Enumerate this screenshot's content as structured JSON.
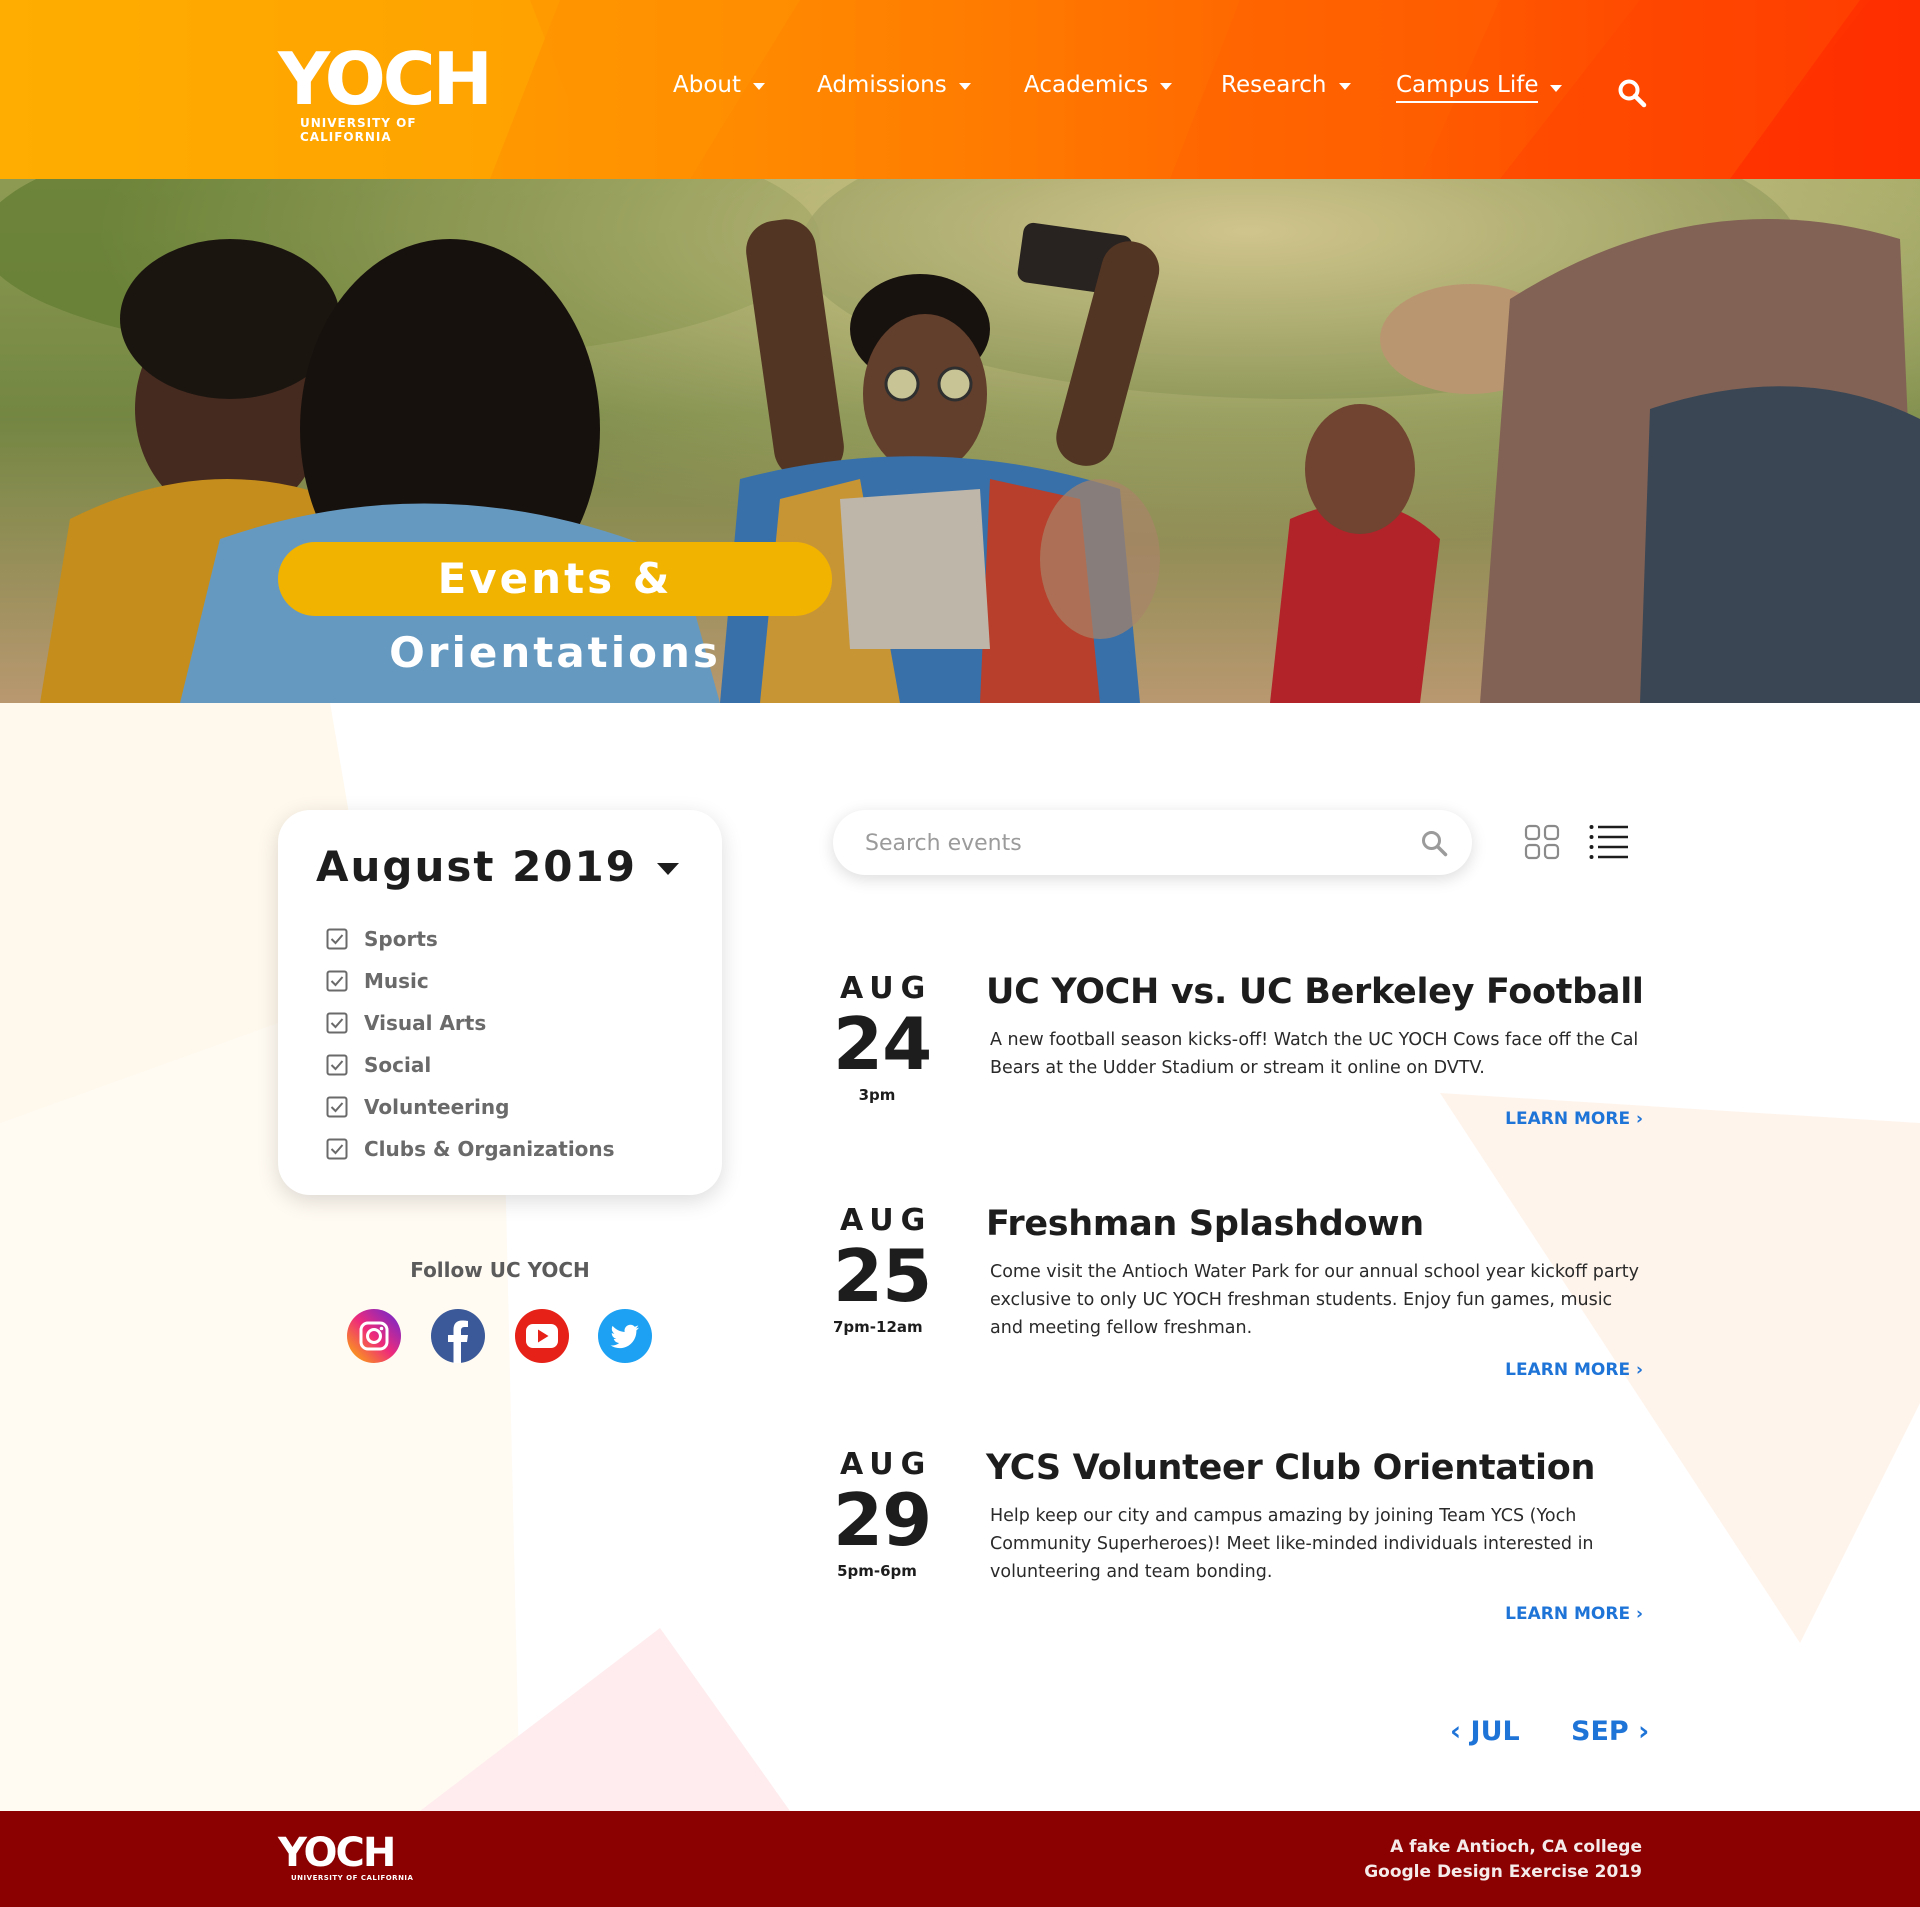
{
  "brand": {
    "name": "YOCH",
    "subtitle": "UNIVERSITY OF CALIFORNIA"
  },
  "nav": {
    "items": [
      {
        "label": "About"
      },
      {
        "label": "Admissions"
      },
      {
        "label": "Academics"
      },
      {
        "label": "Research"
      },
      {
        "label": "Campus Life",
        "active": true
      }
    ],
    "search_icon": "search-icon"
  },
  "hero": {
    "title": "Events & Orientations"
  },
  "filters": {
    "month": "August 2019",
    "categories": [
      {
        "label": "Sports",
        "checked": true
      },
      {
        "label": "Music",
        "checked": true
      },
      {
        "label": "Visual Arts",
        "checked": true
      },
      {
        "label": "Social",
        "checked": true
      },
      {
        "label": "Volunteering",
        "checked": true
      },
      {
        "label": "Clubs & Organizations",
        "checked": true
      }
    ]
  },
  "social": {
    "heading": "Follow UC YOCH",
    "icons": [
      "instagram-icon",
      "facebook-icon",
      "youtube-icon",
      "twitter-icon"
    ]
  },
  "search": {
    "placeholder": "Search events",
    "value": ""
  },
  "view_toggle": {
    "icons": [
      "grid-view-icon",
      "list-view-icon"
    ]
  },
  "events": [
    {
      "month": "AUG",
      "day": "24",
      "time": "3pm",
      "title": "UC YOCH vs. UC Berkeley Football",
      "description": "A new football season kicks-off! Watch the UC YOCH Cows face off the Cal Bears at the Udder Stadium or stream it online on DVTV.",
      "link": "LEARN MORE ›"
    },
    {
      "month": "AUG",
      "day": "25",
      "time": "7pm-12am",
      "title": "Freshman Splashdown",
      "description": "Come visit the Antioch Water Park for our annual school year kickoff party exclusive to only UC YOCH freshman students. Enjoy fun games, music and meeting fellow freshman.",
      "link": "LEARN MORE ›"
    },
    {
      "month": "AUG",
      "day": "29",
      "time": "5pm-6pm",
      "title": "YCS Volunteer Club Orientation",
      "description": "Help keep our city and campus amazing by joining Team YCS (Yoch Community Superheroes)! Meet like-minded individuals interested in volunteering and team bonding.",
      "link": "LEARN MORE ›"
    }
  ],
  "pagination": {
    "prev": "‹ JUL",
    "next": "SEP ›"
  },
  "footer": {
    "line1": "A fake Antioch, CA college",
    "line2": "Google Design Exercise 2019"
  },
  "colors": {
    "header_gradient_start": "#ffb000",
    "header_gradient_end": "#ff3500",
    "accent_yellow": "#f2b300",
    "link_blue": "#1f74d8",
    "footer_red": "#8b0000",
    "text_dark": "#1d1d1d"
  }
}
